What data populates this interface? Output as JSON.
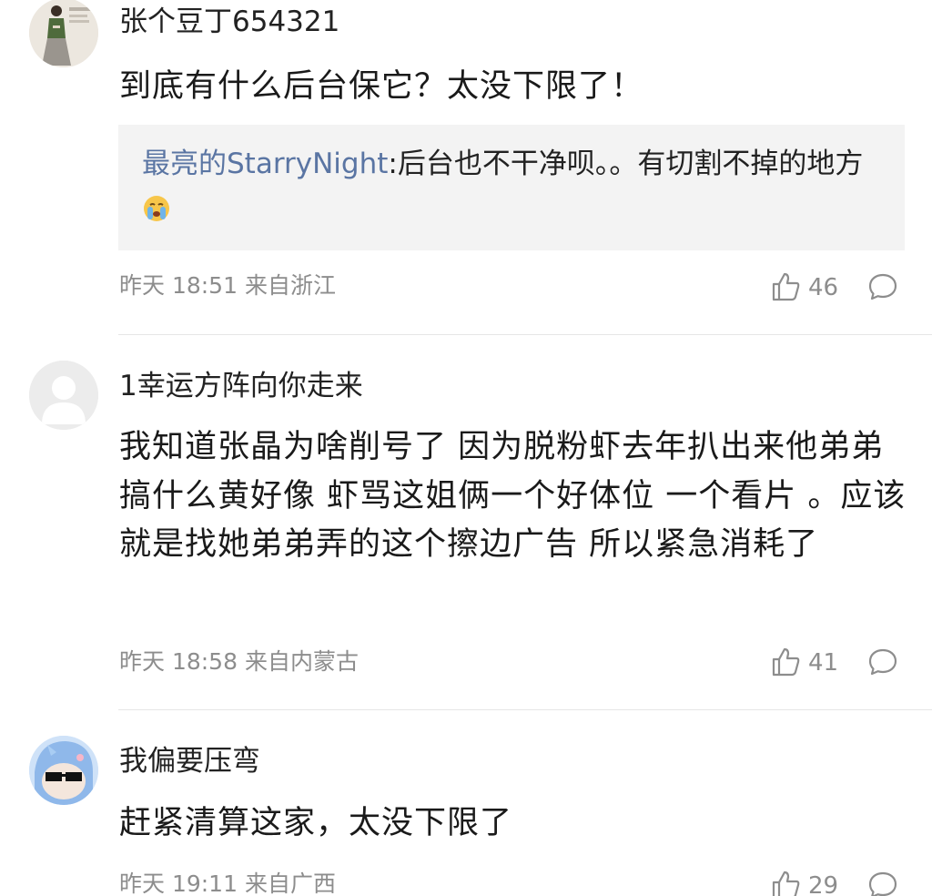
{
  "comments": [
    {
      "username": "张个豆丁654321",
      "avatar": "woman-figure-avatar",
      "text": "到底有什么后台保它？太没下限了！",
      "reply": {
        "user": "最亮的StarryNight",
        "text": ":后台也不干净呗。。有切割不掉的地方",
        "emoji": "crying-emoji"
      },
      "time": "昨天 18:51",
      "location": "来自浙江",
      "likes": "46"
    },
    {
      "username": "1幸运方阵向你走来",
      "avatar": "default-avatar",
      "text": "我知道张晶为啥削号了 因为脱粉虾去年扒出来他弟弟搞什么黄好像 虾骂这姐俩一个好体位 一个看片 。应该就是找她弟弟弄的这个擦边广告 所以紧急消耗了",
      "time": "昨天 18:58",
      "location": "来自内蒙古",
      "likes": "41"
    },
    {
      "username": "我偏要压弯",
      "avatar": "cartoon-sunglasses-avatar",
      "text": "赶紧清算这家，太没下限了",
      "time": "昨天 19:11",
      "location": "来自广西",
      "likes": "29"
    }
  ],
  "colors": {
    "reply_user": "#5a75a3",
    "meta_text": "#8d8d8d",
    "reply_bg": "#f3f3f3"
  }
}
